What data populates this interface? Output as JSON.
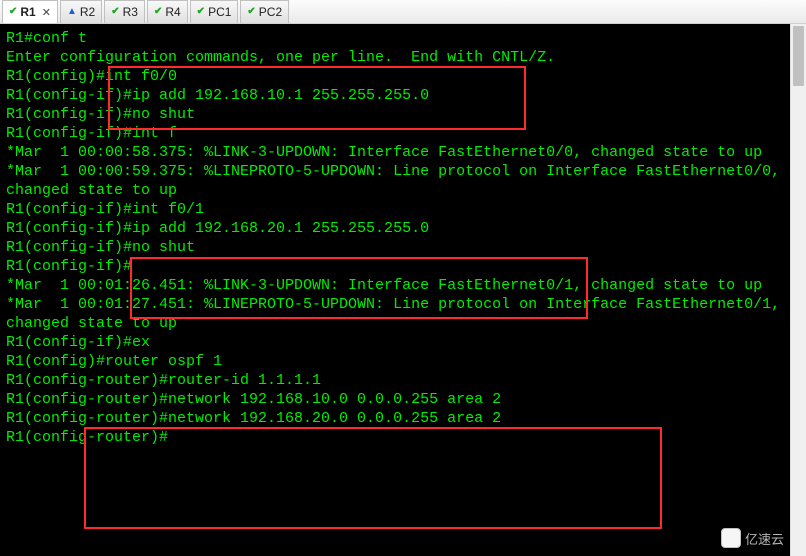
{
  "tabs": [
    {
      "label": "R1",
      "icon": "check",
      "active": true,
      "closable": true
    },
    {
      "label": "R2",
      "icon": "warn",
      "active": false,
      "closable": false
    },
    {
      "label": "R3",
      "icon": "check",
      "active": false,
      "closable": false
    },
    {
      "label": "R4",
      "icon": "check",
      "active": false,
      "closable": false
    },
    {
      "label": "PC1",
      "icon": "check",
      "active": false,
      "closable": false
    },
    {
      "label": "PC2",
      "icon": "check",
      "active": false,
      "closable": false
    }
  ],
  "terminal_lines": [
    "R1#conf t",
    "Enter configuration commands, one per line.  End with CNTL/Z.",
    "R1(config)#int f0/0",
    "R1(config-if)#ip add 192.168.10.1 255.255.255.0",
    "R1(config-if)#no shut",
    "R1(config-if)#int f",
    "*Mar  1 00:00:58.375: %LINK-3-UPDOWN: Interface FastEthernet0/0, changed state to up",
    "*Mar  1 00:00:59.375: %LINEPROTO-5-UPDOWN: Line protocol on Interface FastEthernet0/0, changed state to up",
    "R1(config-if)#int f0/1",
    "R1(config-if)#ip add 192.168.20.1 255.255.255.0",
    "R1(config-if)#no shut",
    "R1(config-if)#",
    "*Mar  1 00:01:26.451: %LINK-3-UPDOWN: Interface FastEthernet0/1, changed state to up",
    "*Mar  1 00:01:27.451: %LINEPROTO-5-UPDOWN: Line protocol on Interface FastEthernet0/1, changed state to up",
    "R1(config-if)#ex",
    "R1(config)#router ospf 1",
    "R1(config-router)#router-id 1.1.1.1",
    "R1(config-router)#network 192.168.10.0 0.0.0.255 area 2",
    "R1(config-router)#network 192.168.20.0 0.0.0.255 area 2",
    "R1(config-router)#"
  ],
  "watermark": "亿速云"
}
